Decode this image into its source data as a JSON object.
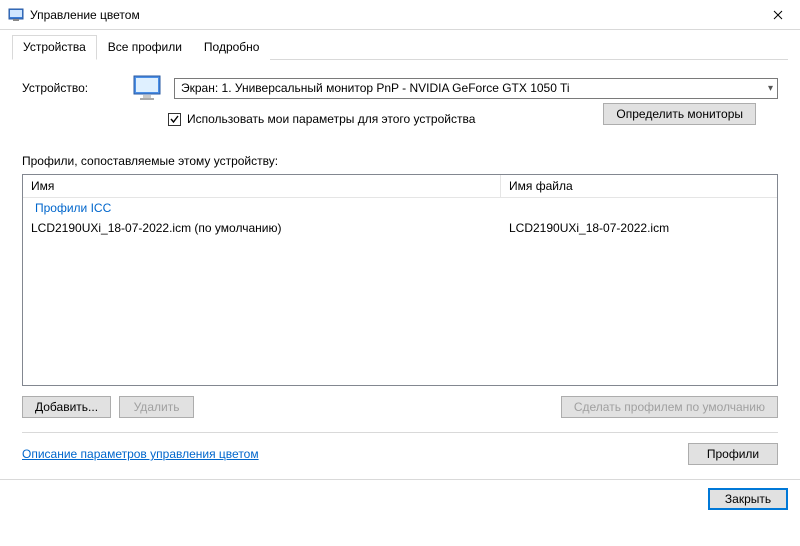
{
  "window": {
    "title": "Управление цветом"
  },
  "tabs": {
    "devices": "Устройства",
    "all_profiles": "Все профили",
    "advanced": "Подробно"
  },
  "device": {
    "label": "Устройство:",
    "selected": "Экран: 1. Универсальный монитор PnP - NVIDIA GeForce GTX 1050 Ti",
    "use_my_settings": "Использовать мои параметры для этого устройства",
    "identify_button": "Определить мониторы"
  },
  "profiles": {
    "section_label": "Профили, сопоставляемые этому устройству:",
    "columns": {
      "name": "Имя",
      "file": "Имя файла"
    },
    "group_label": "Профили ICC",
    "rows": [
      {
        "name": "LCD2190UXi_18-07-2022.icm (по умолчанию)",
        "file": "LCD2190UXi_18-07-2022.icm"
      }
    ],
    "add_button": "Добавить...",
    "remove_button": "Удалить",
    "set_default_button": "Сделать профилем по умолчанию"
  },
  "footer": {
    "link": "Описание параметров управления цветом",
    "profiles_button": "Профили",
    "close_button": "Закрыть"
  }
}
